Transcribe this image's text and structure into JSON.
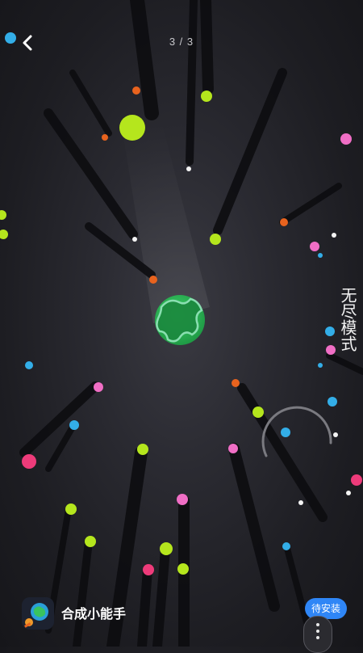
{
  "header": {
    "page_indicator": "3 / 3"
  },
  "game": {
    "mode_label": "无尽模式"
  },
  "app_bar": {
    "app_name": "合成小能手",
    "install_label": "待安装"
  },
  "icons": {
    "back": "chevron-left-icon",
    "more": "vertical-dots-icon",
    "planet": "planet-icon",
    "app": "app-planet-icon"
  },
  "colors": {
    "lime": "#b5e61d",
    "orange": "#e8631e",
    "pink": "#f06ec5",
    "magenta": "#ee3b7a",
    "blue": "#33aee8",
    "white": "#f4f4f4",
    "planet_green": "#2fbf5a",
    "install_blue": "#2f86f6"
  }
}
